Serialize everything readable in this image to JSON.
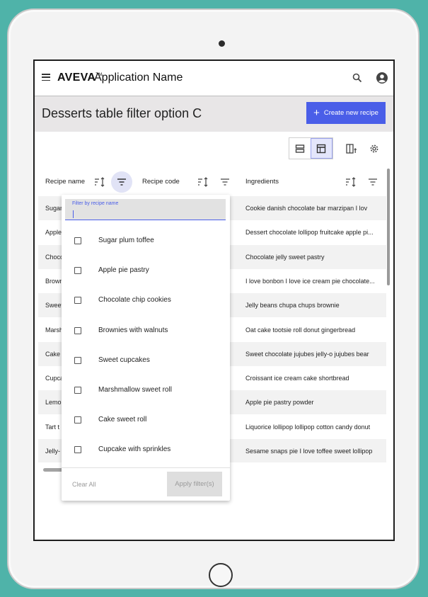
{
  "app": {
    "brand": "AVEVA",
    "trademark": "TM",
    "app_name": "Application Name"
  },
  "page": {
    "title": "Desserts table filter option C",
    "create_button": "Create new recipe"
  },
  "table": {
    "columns": [
      "Recipe name",
      "Recipe code",
      "Ingredients"
    ],
    "rows": [
      {
        "name": "Sugar",
        "ingredients": "Cookie danish chocolate bar marzipan I lov"
      },
      {
        "name": "Apple",
        "ingredients": "Dessert chocolate lollipop fruitcake apple pi..."
      },
      {
        "name": "Choco",
        "ingredients": "Chocolate jelly sweet pastry"
      },
      {
        "name": "Brown",
        "ingredients": "I love bonbon I love ice cream pie chocolate..."
      },
      {
        "name": "Sweet",
        "ingredients": "Jelly beans chupa chups brownie"
      },
      {
        "name": "Marsh",
        "ingredients": "Oat cake tootsie roll donut gingerbread"
      },
      {
        "name": "Cake",
        "ingredients": "Sweet chocolate jujubes jelly-o jujubes bear"
      },
      {
        "name": "Cupca",
        "ingredients": "Croissant ice cream cake shortbread"
      },
      {
        "name": "Lemo",
        "ingredients": "Apple pie pastry powder"
      },
      {
        "name": "Tart t",
        "ingredients": "Liquorice lollipop lollipop cotton candy donut"
      },
      {
        "name": "Jelly-",
        "ingredients": "Sesame snaps pie I love toffee sweet lollipop"
      }
    ]
  },
  "filter_popup": {
    "field_label": "Filter by recipe name",
    "field_value": "",
    "options": [
      "Sugar plum toffee",
      "Apple pie pastry",
      "Chocolate chip cookies",
      "Brownies with walnuts",
      "Sweet cupcakes",
      "Marshmallow sweet roll",
      "Cake sweet roll",
      "Cupcake with sprinkles"
    ],
    "clear_label": "Clear All",
    "apply_label": "Apply filter(s)"
  },
  "colors": {
    "accent": "#4a5ee8",
    "background": "#4fb3a9",
    "title_bar": "#e8e6e7"
  },
  "icons": [
    "menu-icon",
    "search-icon",
    "account-icon",
    "plus-icon",
    "list-view-icon",
    "table-view-icon",
    "columns-icon",
    "gear-icon",
    "sort-icon",
    "filter-icon"
  ]
}
